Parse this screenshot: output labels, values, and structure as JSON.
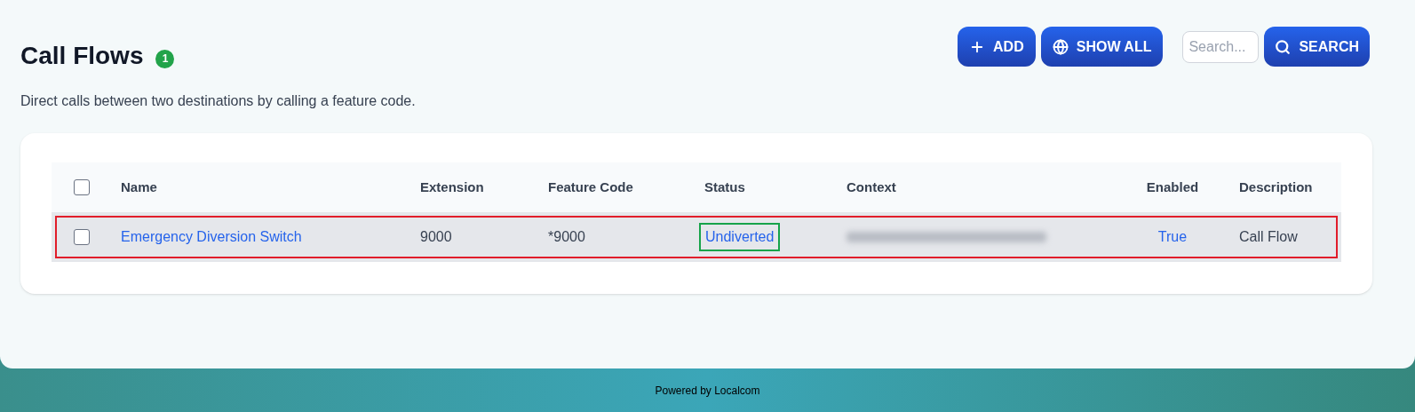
{
  "page": {
    "title": "Call Flows",
    "count": "1",
    "description": "Direct calls between two destinations by calling a feature code."
  },
  "toolbar": {
    "buttons": [
      {
        "label": "ADD",
        "kind": "add"
      },
      {
        "label": "SHOW ALL",
        "kind": "show_all"
      }
    ],
    "search": {
      "placeholder": "Search...",
      "button": "SEARCH"
    }
  },
  "table": {
    "select_all": {
      "checked": false
    },
    "columns": [
      "Name",
      "Extension",
      "Feature Code",
      "Status",
      "Context",
      "Enabled",
      "Description"
    ],
    "rows": [
      {
        "checked": false,
        "highlighted": true,
        "name": "Emergency Diversion Switch",
        "extension": "9000",
        "feature_code": "*9000",
        "status": {
          "text": "Undiverted",
          "highlighted": true
        },
        "context": {
          "redacted": true
        },
        "enabled": "True",
        "description": "Call Flow"
      }
    ]
  },
  "footer": {
    "text": "Powered by Localcom"
  }
}
